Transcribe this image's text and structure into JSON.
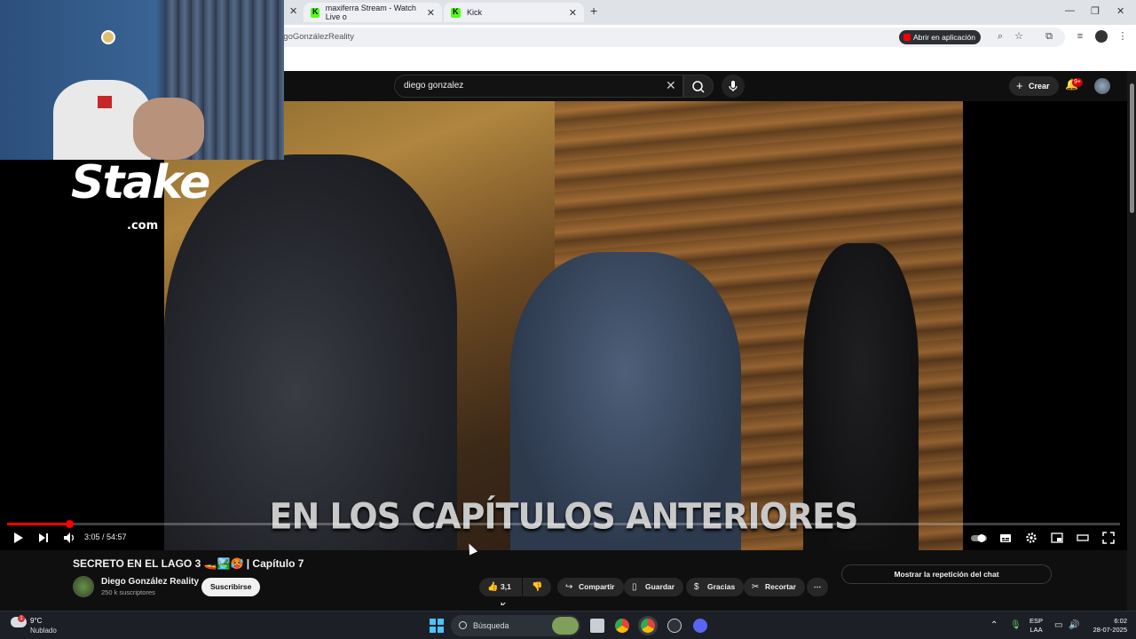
{
  "browser": {
    "tabs": [
      {
        "title": "maxiferra Stream - Watch Live o"
      },
      {
        "title": "Kick"
      }
    ],
    "address": "egoGonzálezReality",
    "open_in_app": "Abrir en aplicación"
  },
  "youtube": {
    "search_query": "diego gonzalez",
    "create_label": "Crear",
    "notification_count": "9+"
  },
  "overlay": {
    "stake_logo": "Stake",
    "stake_domain": ".com"
  },
  "player": {
    "subtitle": "EN LOS CAPÍTULOS ANTERIORES",
    "time": "3:05 / 54:57",
    "progress": 0.056
  },
  "video": {
    "title": "SECRETO EN EL LAGO 3 🚤🏞️🥵 | Capítulo 7",
    "channel_name": "Diego González Reality",
    "subscribers": "250 k suscriptores",
    "subscribe_label": "Suscribirse",
    "likes": "3,1 K",
    "share_label": "Compartir",
    "save_label": "Guardar",
    "thanks_label": "Gracias",
    "clip_label": "Recortar",
    "chat_replay_label": "Mostrar la repetición del chat"
  },
  "taskbar": {
    "temperature": "9°C",
    "weather": "Nublado",
    "weather_badge": "1",
    "search_placeholder": "Búsqueda",
    "lang_line1": "ESP",
    "lang_line2": "LAA",
    "time": "6:02",
    "date": "28-07-2025"
  }
}
